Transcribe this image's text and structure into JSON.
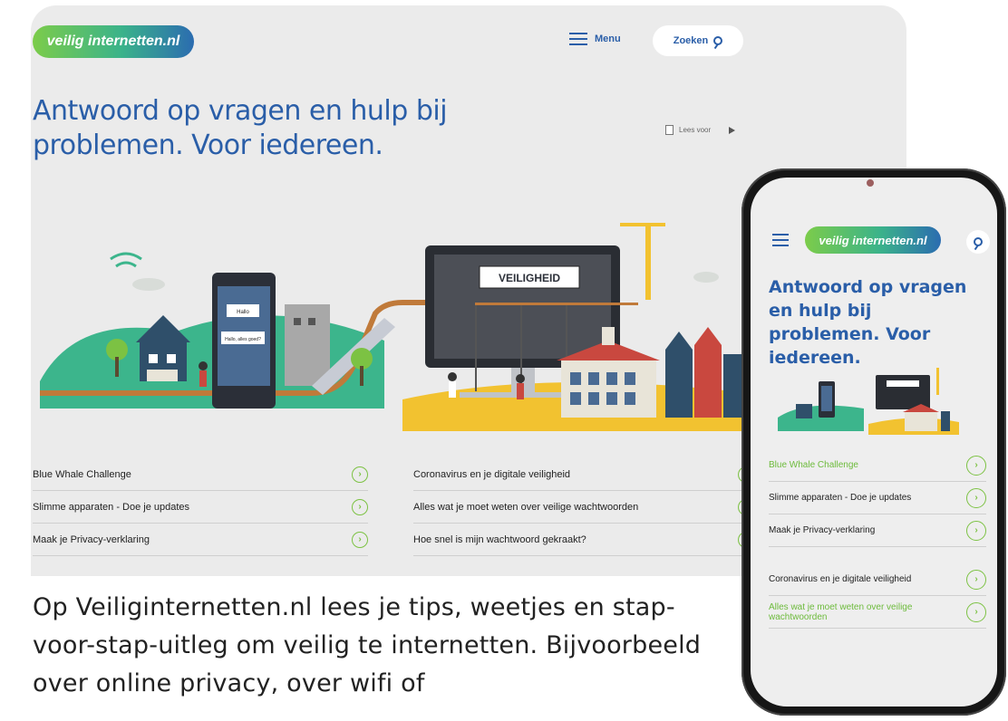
{
  "desktop": {
    "logo": "veilig internetten.nl",
    "menu_label": "Menu",
    "search_label": "Zoeken",
    "hero_title": "Antwoord op vragen en hulp bij problemen. Voor iedereen.",
    "read_aloud": "Lees voor",
    "illustration_sign": "VEILIGHEID",
    "bubble_1": "Hallo",
    "bubble_2": "Hallo, alles goed?",
    "links_col1": [
      "Blue Whale Challenge",
      "Slimme apparaten - Doe je updates",
      "Maak je Privacy-verklaring"
    ],
    "links_col2": [
      "Coronavirus en je digitale veiligheid",
      "Alles wat je moet weten over veilige wachtwoorden",
      "Hoe snel is mijn wachtwoord gekraakt?"
    ]
  },
  "caption": "Op Veiliginternetten.nl lees je tips, weetjes en stap-voor-stap-uitleg om veilig te internetten. Bijvoorbeeld over online privacy, over wifi of",
  "phone": {
    "logo": "veilig internetten.nl",
    "title": "Antwoord op vragen en hulp bij problemen. Voor iedereen.",
    "links": [
      {
        "label": "Blue Whale Challenge",
        "green": true
      },
      {
        "label": "Slimme apparaten - Doe je updates",
        "green": false
      },
      {
        "label": "Maak je Privacy-verklaring",
        "green": false
      },
      {
        "label": "Coronavirus en je digitale veiligheid",
        "green": false
      },
      {
        "label": "Alles wat je moet weten over veilige wachtwoorden",
        "green": true
      }
    ]
  },
  "colors": {
    "brand_blue": "#2a5ea8",
    "brand_green": "#7cc243",
    "background": "#ebebeb"
  },
  "icons": [
    "hamburger-icon",
    "search-icon",
    "document-icon",
    "play-icon",
    "arrow-circle-icon"
  ]
}
